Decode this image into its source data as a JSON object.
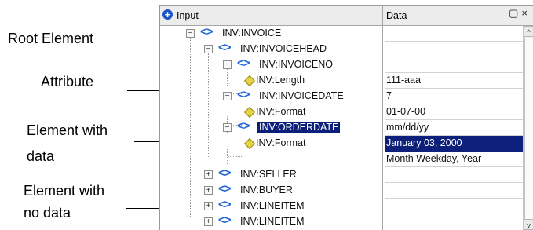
{
  "callouts": {
    "root_element": "Root Element",
    "attribute": "Attribute",
    "element_with_data_1": "Element with",
    "element_with_data_2": "data",
    "element_no_data_1": "Element with",
    "element_no_data_2": "no data"
  },
  "panel": {
    "header_input": "Input",
    "header_data": "Data",
    "header_icons": "restore-icon close-icon",
    "restore_glyph": "▢",
    "close_glyph": "×"
  },
  "tree": {
    "nodes": [
      {
        "label": "INV:INVOICE",
        "type": "element",
        "toggle": "−"
      },
      {
        "label": "INV:INVOICEHEAD",
        "type": "element",
        "toggle": "−"
      },
      {
        "label": "INV:INVOICENO",
        "type": "element",
        "toggle": "−"
      },
      {
        "label": "INV:Length",
        "type": "attribute"
      },
      {
        "label": "INV:INVOICEDATE",
        "type": "element",
        "toggle": "−"
      },
      {
        "label": "INV:Format",
        "type": "attribute"
      },
      {
        "label": "INV:ORDERDATE",
        "type": "element",
        "toggle": "−",
        "selected": true
      },
      {
        "label": "INV:Format",
        "type": "attribute"
      },
      {
        "label": "INV:SELLER",
        "type": "element",
        "toggle": "+"
      },
      {
        "label": "INV:BUYER",
        "type": "element",
        "toggle": "+"
      },
      {
        "label": "INV:LINEITEM",
        "type": "element",
        "toggle": "+"
      },
      {
        "label": "INV:LINEITEM",
        "type": "element",
        "toggle": "+"
      }
    ],
    "bracket_glyph": "<>"
  },
  "data_column": {
    "values": [
      "",
      "",
      "111-aaa",
      "7",
      "01-07-00",
      "mm/dd/yy",
      "January 03, 2000",
      "Month Weekday, Year",
      "",
      "",
      "",
      ""
    ]
  },
  "scrollbar": {
    "up": "^",
    "down": "v"
  },
  "colors": {
    "selection": "#0c1f7a",
    "element_brackets": "#1b63d8",
    "attribute_diamond": "#e6d24a"
  }
}
